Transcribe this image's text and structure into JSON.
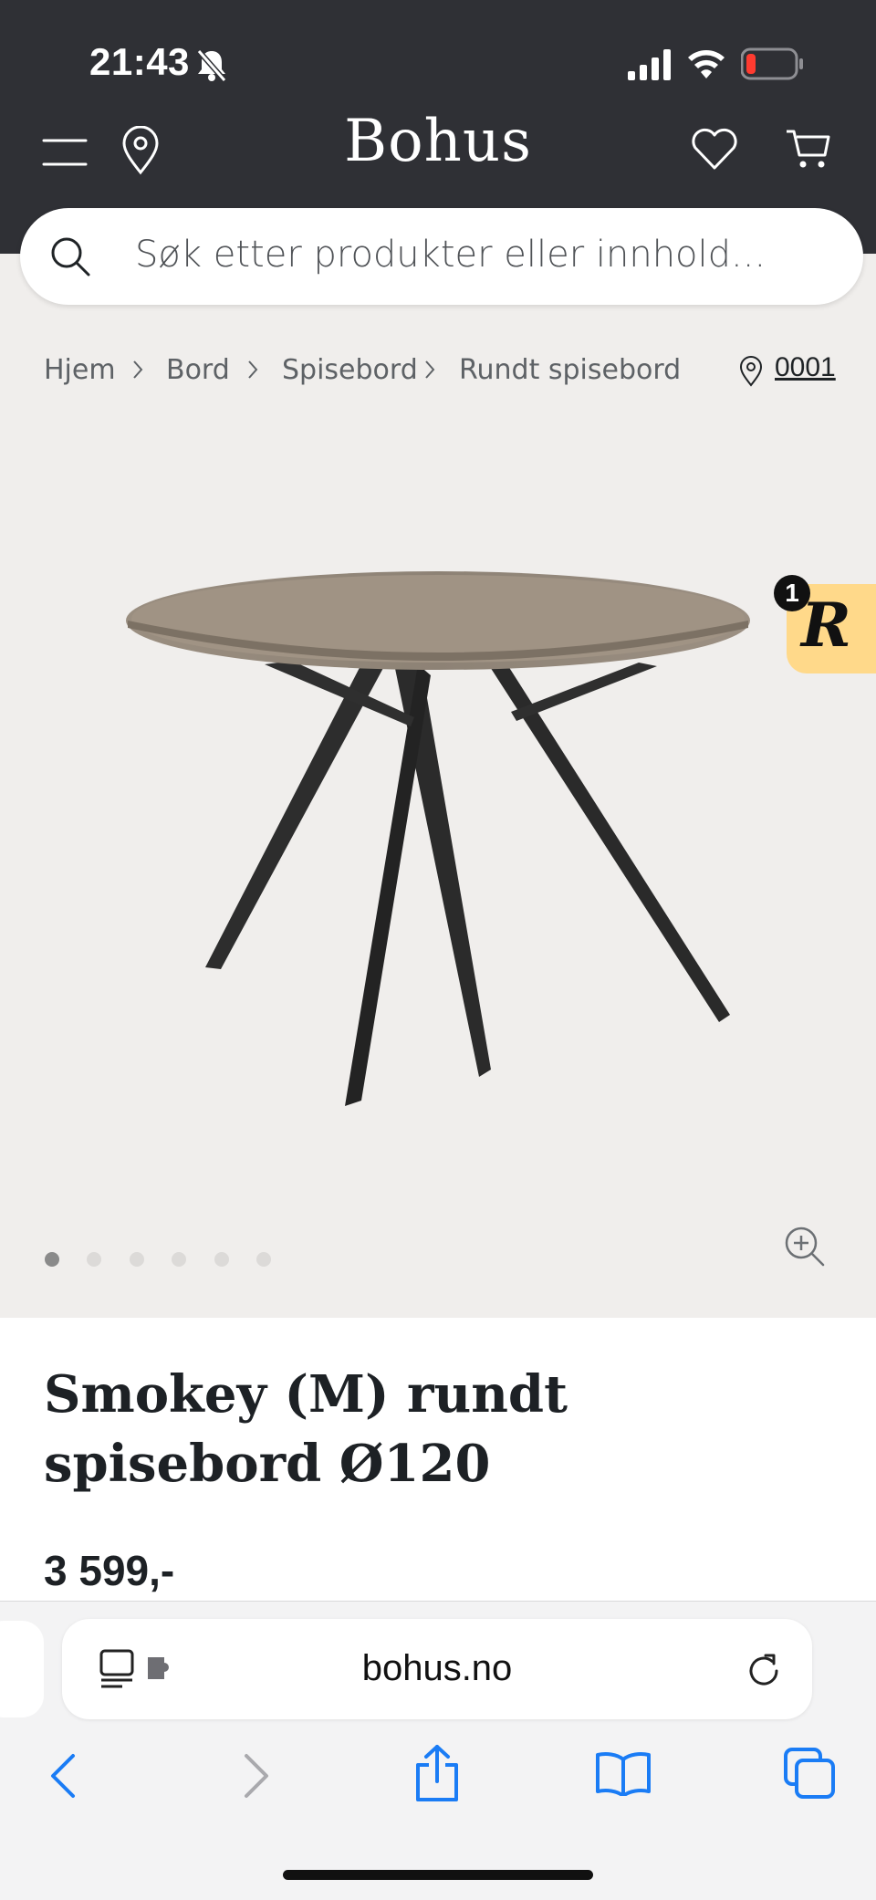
{
  "status_bar": {
    "time": "21:43"
  },
  "header": {
    "logo": "Bohus"
  },
  "search": {
    "placeholder": "Søk etter produkter eller innhold..."
  },
  "breadcrumbs": [
    "Hjem",
    "Bord",
    "Spisebord",
    "Rundt spisebord"
  ],
  "store": {
    "code": "0001"
  },
  "carousel": {
    "dot_count": 6,
    "active_index": 0
  },
  "badge": {
    "count": "1",
    "letter": "R"
  },
  "product": {
    "title": "Smokey (M) rundt spisebord Ø120",
    "price": "3 599,-"
  },
  "browser": {
    "url": "bohus.no"
  }
}
